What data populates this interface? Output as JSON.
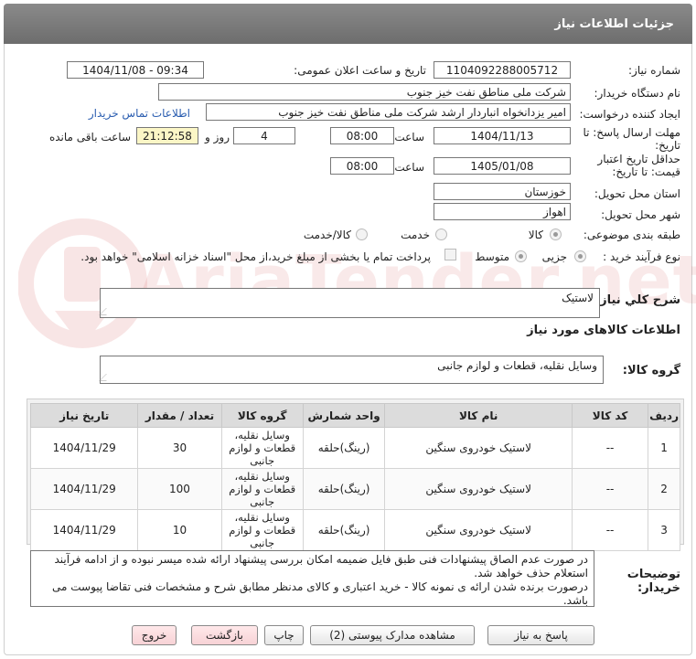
{
  "header": {
    "title": "جزئیات اطلاعات نیاز"
  },
  "watermark": {
    "text": "AriaTender.net"
  },
  "fields": {
    "need_number_label": "شماره نیاز:",
    "need_number": "1104092288005712",
    "announce_label": "تاریخ و ساعت اعلان عمومی:",
    "announce_value": "1404/11/08 - 09:34",
    "buyer_org_label": "نام دستگاه خریدار:",
    "buyer_org": "شرکت ملی مناطق نفت خیز جنوب",
    "requester_label": "ایجاد کننده درخواست:",
    "requester": "امیر یزدانخواه انباردار ارشد شرکت ملی مناطق نفت خیز جنوب",
    "contact_link": "اطلاعات تماس خریدار",
    "deadline_label_1": "مهلت ارسال پاسخ: تا",
    "deadline_label_2": "تاریخ:",
    "deadline_date": "1404/11/13",
    "time_label": "ساعت",
    "deadline_time": "08:00",
    "days_value": "4",
    "days_label": "روز و",
    "remaining_time": "21:12:58",
    "remaining_label": "ساعت باقی مانده",
    "validity_label_1": "حداقل تاریخ اعتبار",
    "validity_label_2": "قیمت: تا تاریخ:",
    "validity_date": "1405/01/08",
    "validity_time": "08:00",
    "province_label": "استان محل تحویل:",
    "province": "خوزستان",
    "city_label": "شهر محل تحویل:",
    "city": "اهواز",
    "category_label": "طبقه بندی موضوعی:",
    "category_options": [
      "کالا",
      "خدمت",
      "کالا/خدمت"
    ],
    "category_selected": "کالا",
    "process_label": "نوع فرآیند خرید :",
    "process_options": [
      "جزیی",
      "متوسط"
    ],
    "process_selected": "جزیی",
    "payment_note": "پرداخت تمام یا بخشی از مبلغ خرید،از محل \"اسناد خزانه اسلامی\" خواهد بود.",
    "summary_label": "شرح کلي نياز:",
    "summary": "لاستیک",
    "goods_info_title": "اطلاعات کالاهای مورد نیاز",
    "goods_group_label": "گروه کالا:",
    "goods_group": "وسایل نقلیه، قطعات و لوازم جانبی"
  },
  "table": {
    "headers": [
      "ردیف",
      "کد کالا",
      "نام کالا",
      "واحد شمارش",
      "گروه کالا",
      "تعداد / مقدار",
      "تاریخ نیاز"
    ],
    "rows": [
      {
        "row": "1",
        "code": "--",
        "name": "لاستیک خودروی سنگین",
        "unit": "(رینگ)حلقه",
        "group_1": "وسایل نقلیه،",
        "group_2": "قطعات و لوازم",
        "group_3": "جانبی",
        "qty": "30",
        "date": "1404/11/29"
      },
      {
        "row": "2",
        "code": "--",
        "name": "لاستیک خودروی سنگین",
        "unit": "(رینگ)حلقه",
        "group_1": "وسایل نقلیه،",
        "group_2": "قطعات و لوازم",
        "group_3": "جانبی",
        "qty": "100",
        "date": "1404/11/29"
      },
      {
        "row": "3",
        "code": "--",
        "name": "لاستیک خودروی سنگین",
        "unit": "(رینگ)حلقه",
        "group_1": "وسایل نقلیه،",
        "group_2": "قطعات و لوازم",
        "group_3": "جانبی",
        "qty": "10",
        "date": "1404/11/29"
      }
    ]
  },
  "notes": {
    "label_1": "توضیحات",
    "label_2": "خریدار:",
    "line_1": "در صورت عدم الصاق پیشنهادات فنی طبق فایل ضمیمه امکان بررسی پیشنهاد ارائه شده میسر نبوده و از ادامه فرآیند",
    "line_2": "استعلام حذف خواهد شد.",
    "line_3": "درصورت برنده شدن ارائه ی نمونه کالا - خرید اعتباری و کالای مدنظر مطابق شرح و مشخصات فنی تقاضا پیوست می باشد."
  },
  "buttons": {
    "respond": "پاسخ به نیاز",
    "view_docs": "مشاهده مدارک پیوستی (2)",
    "print": "چاپ",
    "back": "بازگشت",
    "exit": "خروج"
  },
  "colors": {
    "header": "#7b7b7b",
    "link": "#2a5db0",
    "highlight": "#fbf6c6",
    "pink_button": "#f7d2d6"
  }
}
